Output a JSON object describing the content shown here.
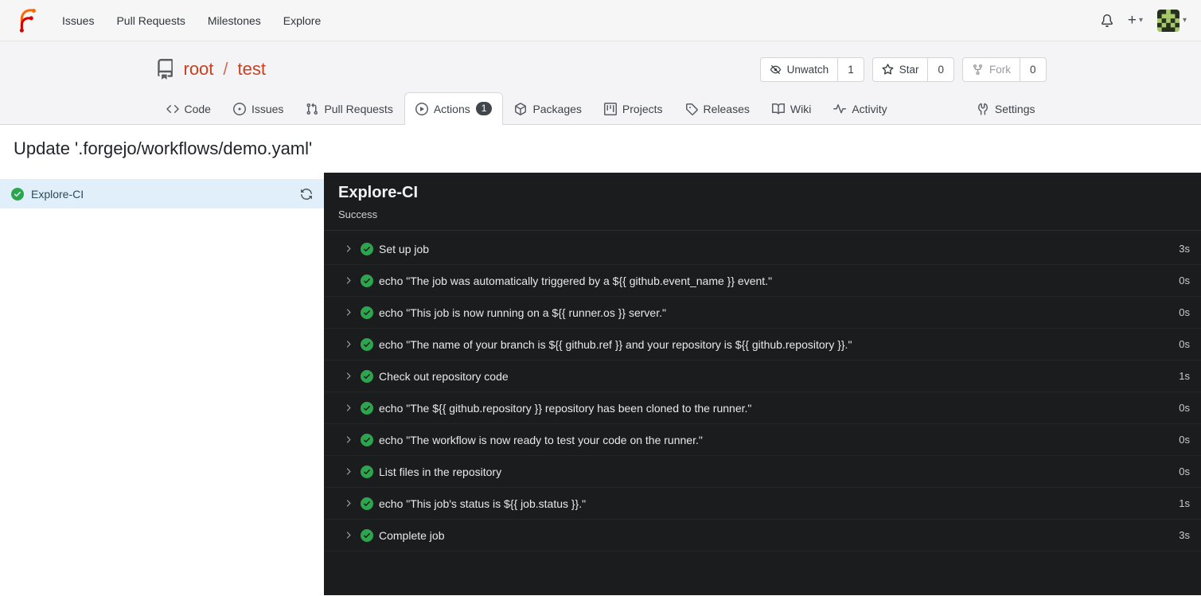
{
  "navbar": {
    "links": [
      "Issues",
      "Pull Requests",
      "Milestones",
      "Explore"
    ],
    "new_button": "+",
    "caret": "▾"
  },
  "repo_header": {
    "owner": "root",
    "separator": "/",
    "name": "test",
    "buttons": [
      {
        "label": "Unwatch",
        "count": "1"
      },
      {
        "label": "Star",
        "count": "0"
      },
      {
        "label": "Fork",
        "count": "0"
      }
    ]
  },
  "tabs": {
    "items": [
      {
        "label": "Code"
      },
      {
        "label": "Issues"
      },
      {
        "label": "Pull Requests"
      },
      {
        "label": "Actions",
        "badge": "1"
      },
      {
        "label": "Packages"
      },
      {
        "label": "Projects"
      },
      {
        "label": "Releases"
      },
      {
        "label": "Wiki"
      },
      {
        "label": "Activity"
      }
    ],
    "settings": {
      "label": "Settings"
    }
  },
  "page": {
    "title": "Update '.forgejo/workflows/demo.yaml'"
  },
  "sidebar": {
    "job": {
      "name": "Explore-CI"
    }
  },
  "job_panel": {
    "title": "Explore-CI",
    "status": "Success",
    "steps": [
      {
        "name": "Set up job",
        "duration": "3s"
      },
      {
        "name": "echo \"The job was automatically triggered by a ${{ github.event_name }} event.\"",
        "duration": "0s"
      },
      {
        "name": "echo \"This job is now running on a ${{ runner.os }} server.\"",
        "duration": "0s"
      },
      {
        "name": "echo \"The name of your branch is ${{ github.ref }} and your repository is ${{ github.repository }}.\"",
        "duration": "0s"
      },
      {
        "name": "Check out repository code",
        "duration": "1s"
      },
      {
        "name": "echo \"The ${{ github.repository }} repository has been cloned to the runner.\"",
        "duration": "0s"
      },
      {
        "name": "echo \"The workflow is now ready to test your code on the runner.\"",
        "duration": "0s"
      },
      {
        "name": "List files in the repository",
        "duration": "0s"
      },
      {
        "name": "echo \"This job's status is ${{ job.status }}.\"",
        "duration": "1s"
      },
      {
        "name": "Complete job",
        "duration": "3s"
      }
    ]
  },
  "colors": {
    "brand_orange": "#ff6600",
    "brand_red": "#d40000",
    "repo_link_red": "#c7401f",
    "success_green": "#2da44e",
    "selected_job_bg": "#e1effa",
    "log_panel_bg": "#1b1c1e",
    "actions_badge_bg": "#41464c"
  }
}
